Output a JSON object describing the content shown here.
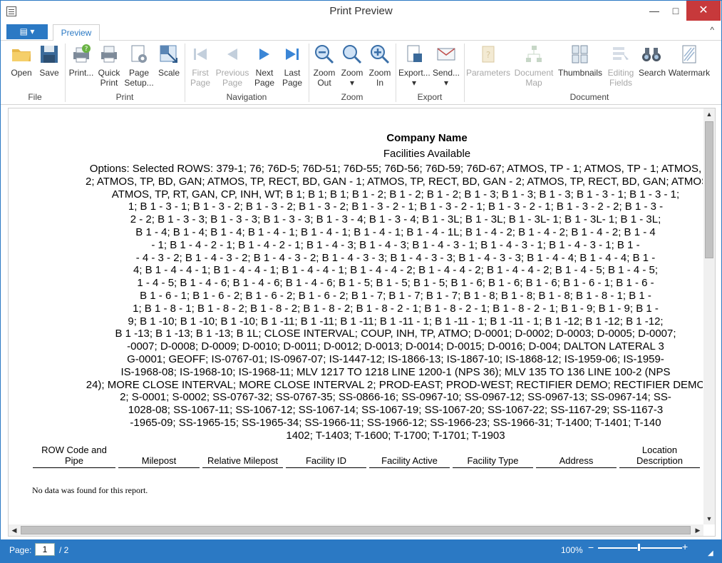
{
  "window": {
    "title": "Print Preview",
    "min": "—",
    "max": "□",
    "close": "✕"
  },
  "tabs": {
    "file": "▤ ▾",
    "preview": "Preview",
    "collapse": "^"
  },
  "ribbon": {
    "open": "Open",
    "save": "Save",
    "file_group": "File",
    "print": "Print...",
    "quick_print_1": "Quick",
    "quick_print_2": "Print",
    "page_setup_1": "Page",
    "page_setup_2": "Setup...",
    "scale": "Scale",
    "print_group": "Print",
    "first_1": "First",
    "first_2": "Page",
    "prev_1": "Previous",
    "prev_2": "Page",
    "next_1": "Next",
    "next_2": "Page",
    "last_1": "Last",
    "last_2": "Page",
    "nav_group": "Navigation",
    "zoom_out_1": "Zoom",
    "zoom_out_2": "Out",
    "zoom": "Zoom",
    "zoom_in_1": "Zoom",
    "zoom_in_2": "In",
    "zoom_group": "Zoom",
    "export": "Export...",
    "send": "Send...",
    "export_group": "Export",
    "parameters": "Parameters",
    "docmap_1": "Document",
    "docmap_2": "Map",
    "thumbnails": "Thumbnails",
    "editing_1": "Editing",
    "editing_2": "Fields",
    "search": "Search",
    "watermark": "Watermark",
    "document_group": "Document"
  },
  "report": {
    "company": "Company Name",
    "subtitle": "Facilities Available",
    "options_lines": [
      "Options: Selected ROWS: 379-1; 76; 76D-5; 76D-51; 76D-55; 76D-56; 76D-59; 76D-67; ATMOS, TP - 1; ATMOS, TP - 1; ATMOS,",
      "2; ATMOS, TP, BD, GAN; ATMOS, TP, RECT, BD, GAN - 1; ATMOS, TP, RECT, BD, GAN - 2; ATMOS, TP, RECT, BD, GAN; ATMOS,",
      "ATMOS, TP, RT, GAN, CP, INH, WT; B 1; B 1; B 1; B 1 - 2; B 1 - 2; B 1 - 2; B 1 - 3; B 1 - 3; B 1 - 3; B 1 - 3 - 1; B 1 - 3 - 1;",
      "1; B 1 - 3 - 1; B 1 - 3 - 2; B 1 - 3 - 2; B 1 - 3 - 2; B 1 - 3 - 2 - 1; B 1 - 3 - 2 - 1; B 1 - 3 - 2 - 1; B 1 - 3 - 2 - 2; B 1 - 3 -",
      "2 - 2; B 1 - 3 - 3; B 1 - 3 - 3; B 1 - 3 - 3; B 1 - 3 - 4; B 1 - 3 - 4; B 1 - 3L; B 1 - 3L; B 1 - 3L- 1; B 1 - 3L- 1; B 1 - 3L;",
      "B 1 - 4; B 1 - 4; B 1 - 4; B 1 - 4 - 1; B 1 - 4 - 1; B 1 - 4 - 1; B 1 - 4 - 1L; B 1 - 4 - 2; B 1 - 4 - 2; B 1 - 4 - 2; B 1 - 4",
      "- 1; B 1 - 4 - 2 - 1; B 1 - 4 - 2 - 1; B 1 - 4 - 3; B 1 - 4 - 3; B 1 - 4 - 3 - 1; B 1 - 4 - 3 - 1; B 1 - 4 - 3 - 1; B 1 -",
      "- 4 - 3 - 2; B 1 - 4 - 3 - 2; B 1 - 4 - 3 - 2; B 1 - 4 - 3 - 3; B 1 - 4 - 3 - 3; B 1 - 4 - 3 - 3; B 1 - 4 - 4; B 1 - 4 - 4; B 1 -",
      "4; B 1 - 4 - 4 - 1; B 1 - 4 - 4 - 1; B 1 - 4 - 4 - 1; B 1 - 4 - 4 - 2; B 1 - 4 - 4 - 2; B 1 - 4 - 4 - 2; B 1 - 4 - 5; B 1 - 4 - 5;",
      "1 - 4 - 5; B 1 - 4 - 6; B 1 - 4 - 6; B 1 - 4 - 6; B 1 - 5; B 1 - 5; B 1 - 5; B 1 - 6; B 1 - 6; B 1 - 6; B 1 - 6 - 1; B 1 - 6 -",
      "B 1 - 6 - 1; B 1 - 6 - 2; B 1 - 6 - 2; B 1 - 6 - 2; B 1 - 7; B 1 - 7; B 1 - 7; B 1 - 8; B 1 - 8; B 1 - 8; B 1 - 8 - 1; B 1 -",
      "1; B 1 - 8 - 1; B 1 - 8 - 2; B 1 - 8 - 2; B 1 - 8 - 2; B 1 - 8 - 2 - 1; B 1 - 8 - 2 - 1; B 1 - 8 - 2 - 1; B 1 - 9; B 1 - 9; B 1 -",
      "9; B 1 -10; B 1 -10; B 1 -10; B 1 -11; B 1 -11; B 1 -11; B 1 -11 - 1; B 1 -11 - 1; B 1 -11 - 1; B 1 -12; B 1 -12; B 1 -12;",
      "B 1 -13; B 1 -13; B 1 -13; B 1L; CLOSE INTERVAL; COUP, INH, TP, ATMO; D-0001; D-0002; D-0003; D-0005; D-0007;",
      "-0007; D-0008; D-0009; D-0010; D-0011; D-0012; D-0013; D-0014; D-0015; D-0016; D-004; DALTON LATERAL 3",
      "G-0001; GEOFF; IS-0767-01; IS-0967-07; IS-1447-12; IS-1866-13; IS-1867-10; IS-1868-12; IS-1959-06; IS-1959-",
      "IS-1968-08; IS-1968-10; IS-1968-11; MLV 1217 TO 1218 LINE 1200-1 (NPS 36); MLV 135 TO 136 LINE 100-2 (NPS",
      "24); MORE CLOSE INTERVAL; MORE CLOSE INTERVAL 2; PROD-EAST; PROD-WEST; RECTIFIER DEMO; RECTIFIER DEMO",
      "2; S-0001; S-0002; SS-0767-32; SS-0767-35; SS-0866-16; SS-0967-10; SS-0967-12; SS-0967-13; SS-0967-14; SS-",
      "1028-08; SS-1067-11; SS-1067-12; SS-1067-14; SS-1067-19; SS-1067-20; SS-1067-22; SS-1167-29; SS-1167-3",
      "-1965-09; SS-1965-15; SS-1965-34; SS-1966-11; SS-1966-12; SS-1966-23; SS-1966-31; T-1400; T-1401; T-140",
      "1402; T-1403; T-1600; T-1700; T-1701; T-1903"
    ],
    "columns": [
      "ROW Code and Pipe",
      "Milepost",
      "Relative Milepost",
      "Facility ID",
      "Facility Active",
      "Facility Type",
      "Address",
      "Location Description"
    ],
    "no_data": "No data was found for this report."
  },
  "scroll": {
    "up": "▲",
    "down": "▼",
    "left": "◀",
    "right": "▶"
  },
  "status": {
    "page_label": "Page:",
    "page_value": "1",
    "page_total": "/ 2",
    "zoom": "100%",
    "minus": "−",
    "plus": "+"
  }
}
